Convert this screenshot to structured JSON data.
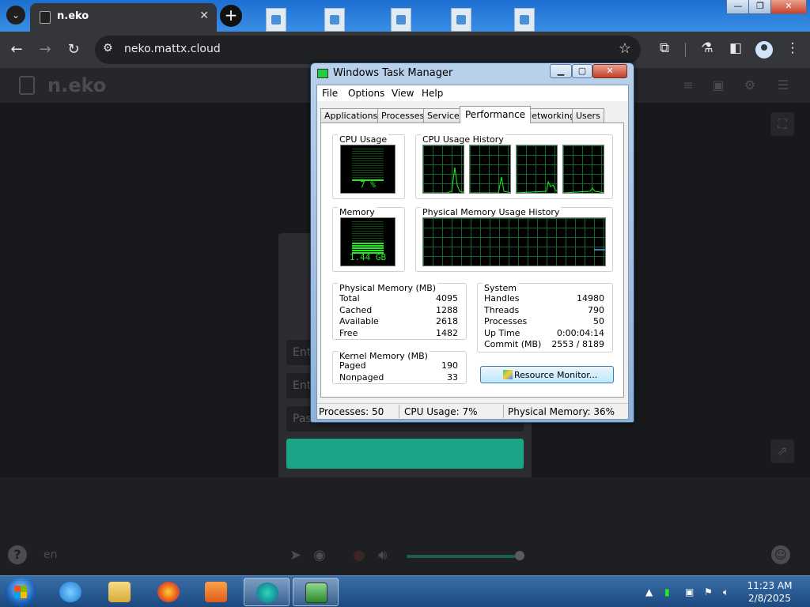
{
  "browser": {
    "tab_title": "n.eko",
    "tab_close": "✕",
    "new_tab": "+",
    "url": "neko.mattx.cloud"
  },
  "neko": {
    "logo": "n.eko",
    "input_1_placeholder": "Ent",
    "input_2_placeholder": "Ent",
    "input_3_placeholder": "Pas",
    "language": "en"
  },
  "task_manager": {
    "title": "Windows Task Manager",
    "menu": [
      "File",
      "Options",
      "View",
      "Help"
    ],
    "tabs": [
      "Applications",
      "Processes",
      "Services",
      "Performance",
      "Networking",
      "Users"
    ],
    "active_tab": "Performance",
    "cpu_usage": {
      "title": "CPU Usage",
      "value_label": "7 %",
      "percent": 7
    },
    "cpu_history": {
      "title": "CPU Usage History",
      "cores": 4
    },
    "memory": {
      "title": "Memory",
      "value_label": "1.44 GB",
      "percent": 36
    },
    "memory_history": {
      "title": "Physical Memory Usage History"
    },
    "physical_memory": {
      "title": "Physical Memory (MB)",
      "rows": [
        {
          "label": "Total",
          "value": "4095"
        },
        {
          "label": "Cached",
          "value": "1288"
        },
        {
          "label": "Available",
          "value": "2618"
        },
        {
          "label": "Free",
          "value": "1482"
        }
      ]
    },
    "kernel_memory": {
      "title": "Kernel Memory (MB)",
      "rows": [
        {
          "label": "Paged",
          "value": "190"
        },
        {
          "label": "Nonpaged",
          "value": "33"
        }
      ]
    },
    "system": {
      "title": "System",
      "rows": [
        {
          "label": "Handles",
          "value": "14980"
        },
        {
          "label": "Threads",
          "value": "790"
        },
        {
          "label": "Processes",
          "value": "50"
        },
        {
          "label": "Up Time",
          "value": "0:00:04:14"
        },
        {
          "label": "Commit (MB)",
          "value": "2553 / 8189"
        }
      ]
    },
    "resource_monitor_button": "Resource Monitor...",
    "status": {
      "processes": "Processes: 50",
      "cpu": "CPU Usage: 7%",
      "memory": "Physical Memory: 36%"
    }
  },
  "taskbar": {
    "time": "11:23 AM",
    "date": "2/8/2025"
  },
  "colors": {
    "meter_green": "#1ef01e",
    "grid_green": "#0f6b2c",
    "neko_accent": "#1ca489",
    "chrome_dark": "#35363a"
  }
}
